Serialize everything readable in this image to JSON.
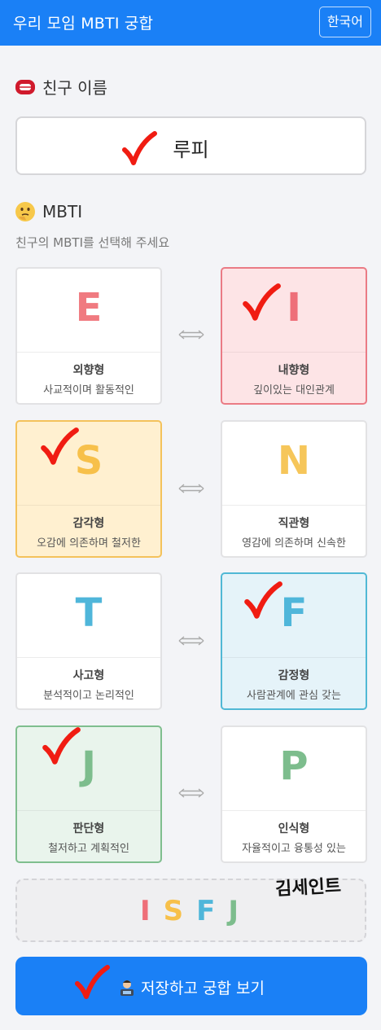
{
  "header": {
    "title": "우리 모임 MBTI 궁합",
    "lang_button": "한국어"
  },
  "name_section": {
    "title": "친구 이름",
    "value": "루피"
  },
  "mbti_section": {
    "title": "MBTI",
    "hint": "친구의 MBTI를 선택해 주세요"
  },
  "pairs": [
    {
      "left": {
        "letter": "E",
        "title": "외향형",
        "desc": "사교적이며 활동적인",
        "selected": false
      },
      "right": {
        "letter": "I",
        "title": "내향형",
        "desc": "깊이있는 대인관계",
        "selected": true
      }
    },
    {
      "left": {
        "letter": "S",
        "title": "감각형",
        "desc": "오감에 의존하며 철저한",
        "selected": true
      },
      "right": {
        "letter": "N",
        "title": "직관형",
        "desc": "영감에 의존하며 신속한",
        "selected": false
      }
    },
    {
      "left": {
        "letter": "T",
        "title": "사고형",
        "desc": "분석적이고 논리적인",
        "selected": false
      },
      "right": {
        "letter": "F",
        "title": "감정형",
        "desc": "사람관계에 관심 갖는",
        "selected": true
      }
    },
    {
      "left": {
        "letter": "J",
        "title": "판단형",
        "desc": "철저하고 계획적인",
        "selected": true
      },
      "right": {
        "letter": "P",
        "title": "인식형",
        "desc": "자율적이고 융통성 있는",
        "selected": false
      }
    }
  ],
  "result": {
    "letters": [
      "I",
      "S",
      "F",
      "J"
    ]
  },
  "signature": "김세인트",
  "save_button": {
    "label": "저장하고 궁합 보기"
  },
  "colors": {
    "primary": "#1a80f6",
    "E": "#f07a80",
    "I": "#ee6f79",
    "S": "#f7c04a",
    "N": "#f6c65a",
    "T": "#4fb6da",
    "F": "#4fb6da",
    "J": "#7dbd8d",
    "P": "#7dbd8d",
    "check": "#f01c12"
  },
  "icons": {
    "name": "lips-icon",
    "mbti": "thinking-face-icon",
    "swap": "left-right-arrow-icon",
    "save": "technologist-icon",
    "annotation": "red-check-mark-icon"
  }
}
